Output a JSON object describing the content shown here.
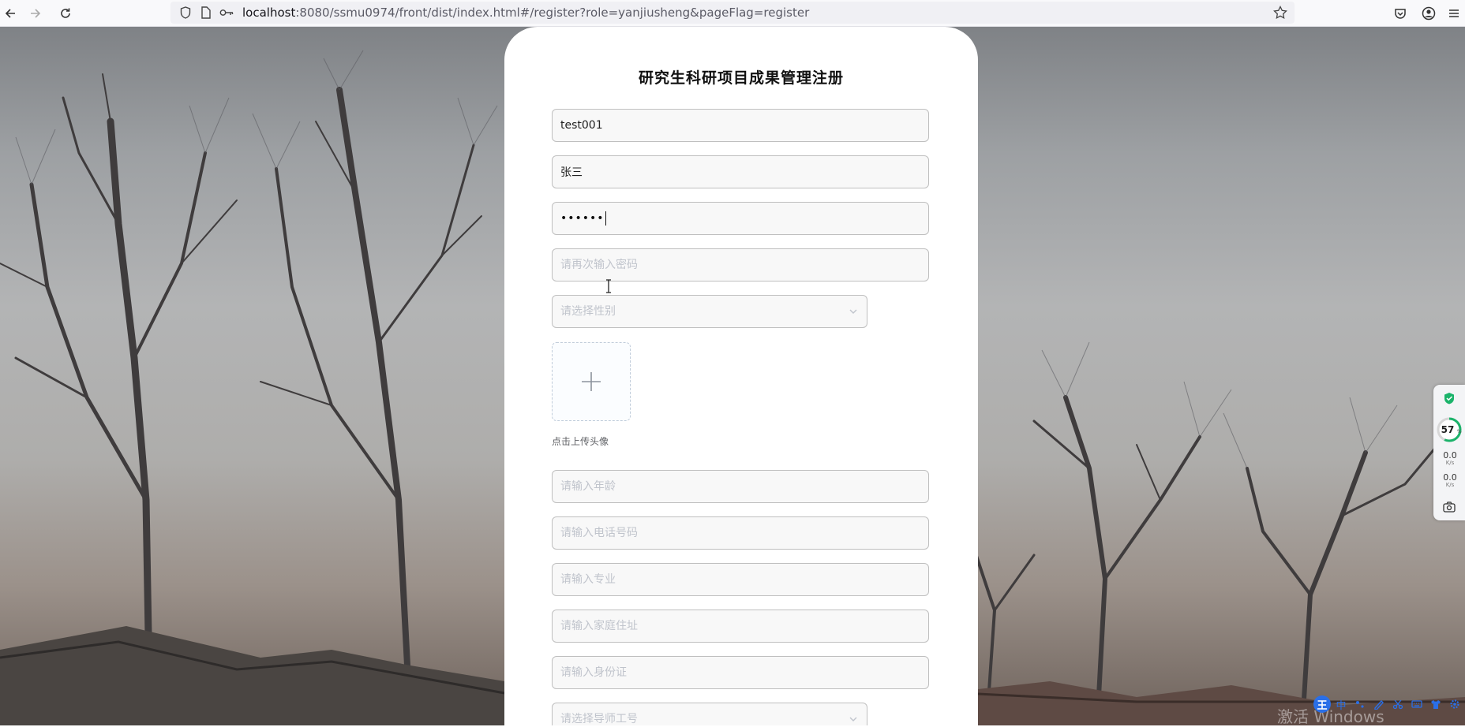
{
  "browser": {
    "url_host": "localhost",
    "url_rest": ":8080/ssmu0974/front/dist/index.html#/register?role=yanjiusheng&pageFlag=register"
  },
  "form": {
    "title": "研究生科研项目成果管理注册",
    "account_value": "test001",
    "name_value": "张三",
    "password_mask": "••••••",
    "confirm_password_placeholder": "请再次输入密码",
    "gender_placeholder": "请选择性别",
    "avatar_hint": "点击上传头像",
    "age_placeholder": "请输入年龄",
    "phone_placeholder": "请输入电话号码",
    "major_placeholder": "请输入专业",
    "address_placeholder": "请输入家庭住址",
    "idcard_placeholder": "请输入身份证",
    "tutor_placeholder": "请选择导师工号"
  },
  "widget": {
    "percent": "57",
    "percent_unit": "%",
    "up_rate": "0.0",
    "down_rate": "0.0",
    "rate_unit": "K/s"
  },
  "ime": {
    "logo": "王",
    "mode": "中"
  },
  "watermark": "激活 Windows",
  "colors": {
    "accent_green": "#1bb36a",
    "ime_blue": "#2a6fe8"
  }
}
